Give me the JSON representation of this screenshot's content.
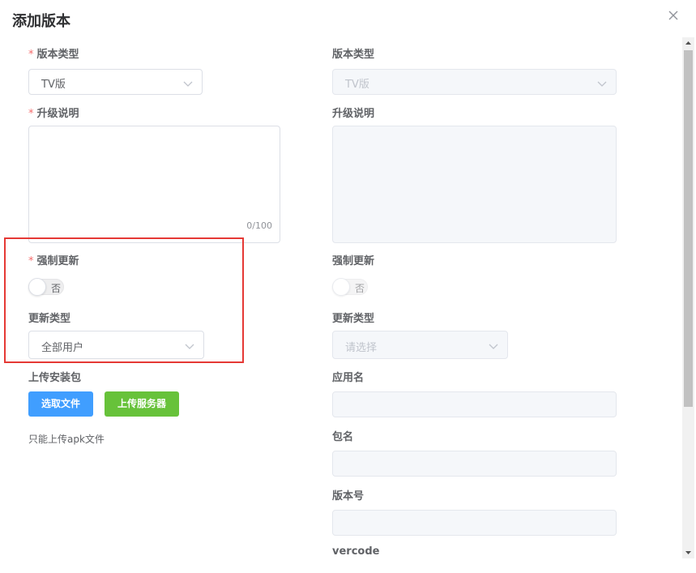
{
  "dialog": {
    "title": "添加版本"
  },
  "left": {
    "version_type": {
      "label": "版本类型",
      "required_mark": "*",
      "value": "TV版"
    },
    "upgrade_desc": {
      "label": "升级说明",
      "required_mark": "*",
      "value": "",
      "counter": "0/100"
    },
    "force_update": {
      "label": "强制更新",
      "required_mark": "*",
      "switch_text": "否",
      "on": false
    },
    "update_type": {
      "label": "更新类型",
      "value": "全部用户"
    },
    "upload": {
      "label": "上传安装包",
      "select_file_label": "选取文件",
      "upload_server_label": "上传服务器",
      "tip": "只能上传apk文件"
    }
  },
  "right": {
    "version_type": {
      "label": "版本类型",
      "value": "TV版"
    },
    "upgrade_desc": {
      "label": "升级说明"
    },
    "force_update": {
      "label": "强制更新",
      "switch_text": "否",
      "on": false
    },
    "update_type": {
      "label": "更新类型",
      "placeholder": "请选择"
    },
    "app_name": {
      "label": "应用名"
    },
    "package_name": {
      "label": "包名"
    },
    "version_number": {
      "label": "版本号"
    },
    "vercode": {
      "label": "vercode"
    }
  },
  "colors": {
    "required": "#f56c6c",
    "primary": "#409eff",
    "success": "#67c23a",
    "highlight": "#e53935"
  },
  "icons": {
    "close": "close-icon",
    "dropdown": "chevron-down-icon",
    "scroll_up": "triangle-up-icon",
    "scroll_down": "triangle-down-icon"
  }
}
